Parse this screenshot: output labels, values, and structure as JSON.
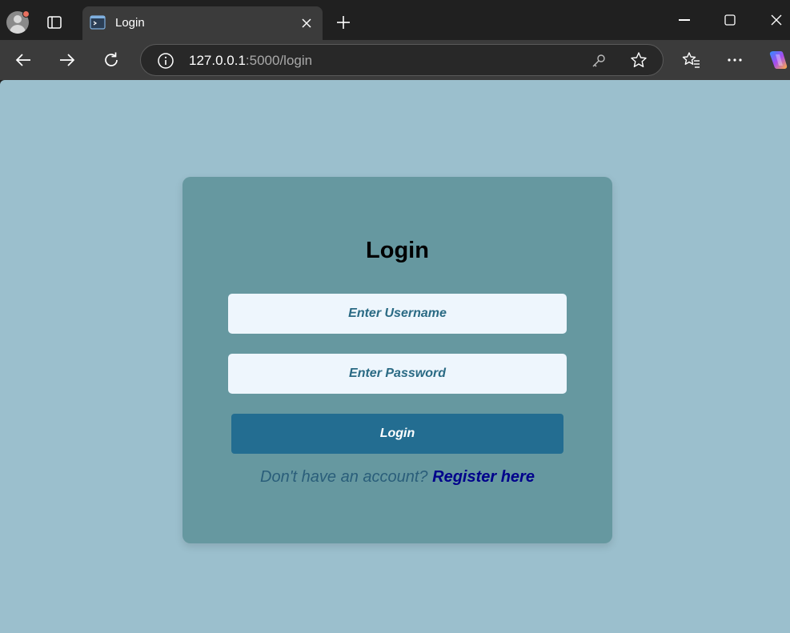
{
  "browser": {
    "tab": {
      "title": "Login",
      "favicon": "terminal-icon"
    },
    "address": {
      "host": "127.0.0.1",
      "rest": ":5000/login"
    },
    "icons": {
      "profile": "profile-avatar-icon",
      "sidebar": "sidebar-toggle-icon",
      "back": "back-arrow-icon",
      "forward": "forward-arrow-icon",
      "refresh": "refresh-icon",
      "info": "info-icon",
      "key": "key-icon",
      "favorite": "star-icon",
      "favorites": "favorites-icon",
      "menu": "more-icon",
      "copilot": "copilot-icon"
    }
  },
  "page": {
    "title": "Login",
    "username_placeholder": "Enter Username",
    "password_placeholder": "Enter Password",
    "login_button": "Login",
    "register_prompt": "Don't have an account?",
    "register_link": "Register here"
  },
  "colors": {
    "background": "#9bbfcd",
    "card": "#6698a0",
    "button": "#236d91",
    "input": "#eef6fd",
    "link": "#00008b"
  }
}
